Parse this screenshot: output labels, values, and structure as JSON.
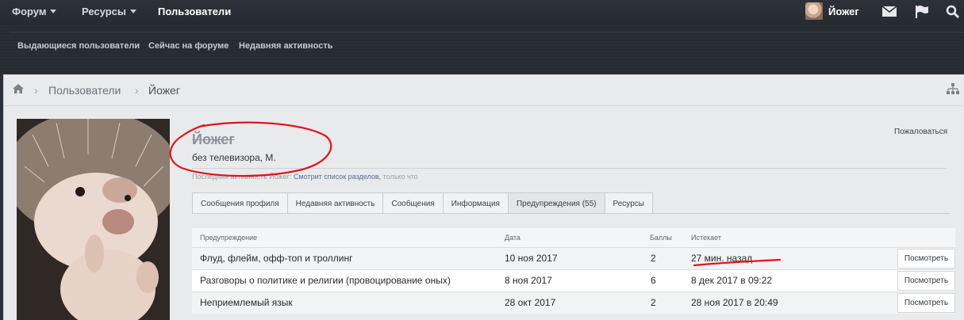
{
  "nav": {
    "tabs": [
      {
        "label": "Форум",
        "dropdown": true
      },
      {
        "label": "Ресурсы",
        "dropdown": true
      },
      {
        "label": "Пользователи",
        "active": true
      }
    ],
    "user_name": "Йожег",
    "icons": [
      "envelope-icon",
      "flag-icon",
      "search-icon"
    ]
  },
  "subnav": {
    "links": [
      "Выдающиеся пользователи",
      "Сейчас на форуме",
      "Недавняя активность"
    ]
  },
  "breadcrumb": {
    "items": [
      "Пользователи",
      "Йожег"
    ]
  },
  "profile": {
    "name": "Йожег",
    "title": "без телевизора, М.",
    "report_label": "Пожаловаться",
    "last_activity_prefix": "Последняя активность Йожег:",
    "last_activity_text": "Смотрит список разделов,",
    "last_activity_time": "только что"
  },
  "tabs": [
    "Сообщения профиля",
    "Недавняя активность",
    "Сообщения",
    "Информация",
    "Предупреждения (55)",
    "Ресурсы"
  ],
  "warnings_table": {
    "headers": [
      "Предупреждение",
      "Дата",
      "Баллы",
      "Истекает"
    ],
    "rows": [
      {
        "warning": "Флуд, флейм, офф-топ и троллинг",
        "date": "10 ноя 2017",
        "points": "2",
        "expires": "27 мин. назад",
        "action": "Посмотреть"
      },
      {
        "warning": "Разговоры о политике и религии (провоцирование оных)",
        "date": "8 ноя 2017",
        "points": "6",
        "expires": "8 дек 2017 в 09:22",
        "action": "Посмотреть"
      },
      {
        "warning": "Неприемлемый язык",
        "date": "28 окт 2017",
        "points": "2",
        "expires": "28 ноя 2017 в 20:49",
        "action": "Посмотреть"
      }
    ]
  },
  "colors": {
    "annotation": "#e0141b",
    "link": "#4f6e9c"
  }
}
